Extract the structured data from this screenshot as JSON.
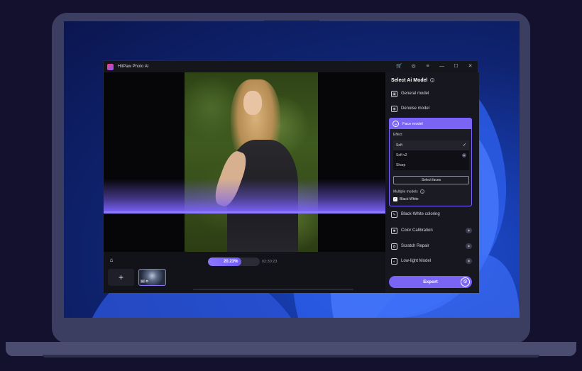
{
  "window": {
    "title": "HitPaw Photo AI"
  },
  "titlebar_icons": {
    "cart": "🛒",
    "account": "◎",
    "menu": "≡",
    "minimize": "—",
    "maximize": "☐",
    "close": "✕"
  },
  "viewer": {
    "progress": {
      "text": "20.23%",
      "value": 0.2023
    },
    "time": "02:30:23",
    "home_icon": "⌂",
    "add_icon": "+",
    "thumb_badge": "🖼 ⚙"
  },
  "panel": {
    "title": "Select Ai Model",
    "info_icon": "i",
    "models": [
      {
        "label": "General model",
        "icon": "▣"
      },
      {
        "label": "Denoise model",
        "icon": "◉"
      }
    ],
    "face_model": {
      "label": "Face model",
      "icon": "☺",
      "effect_label": "Effect",
      "effects": [
        {
          "label": "Soft",
          "mark": "✓"
        },
        {
          "label": "Soft v2",
          "mark": "◈"
        },
        {
          "label": "Sharp",
          "mark": ""
        }
      ],
      "select_faces": "Select faces",
      "multiple_models": "Multiple models",
      "bw_checkbox": "Black-White",
      "check_mark": "✓"
    },
    "more_models": [
      {
        "label": "Black-White coloring",
        "icon": "✎",
        "side": ""
      },
      {
        "label": "Color Calibration",
        "icon": "✺",
        "side": "◈"
      },
      {
        "label": "Scratch Repair",
        "icon": "✿",
        "side": "◈"
      },
      {
        "label": "Low-light Model",
        "icon": "◐",
        "side": "◈"
      }
    ],
    "export_label": "Export",
    "export_settings_icon": "⚙"
  },
  "colors": {
    "accent": "#7a64f4",
    "progress_fill": "#8b77ff"
  }
}
